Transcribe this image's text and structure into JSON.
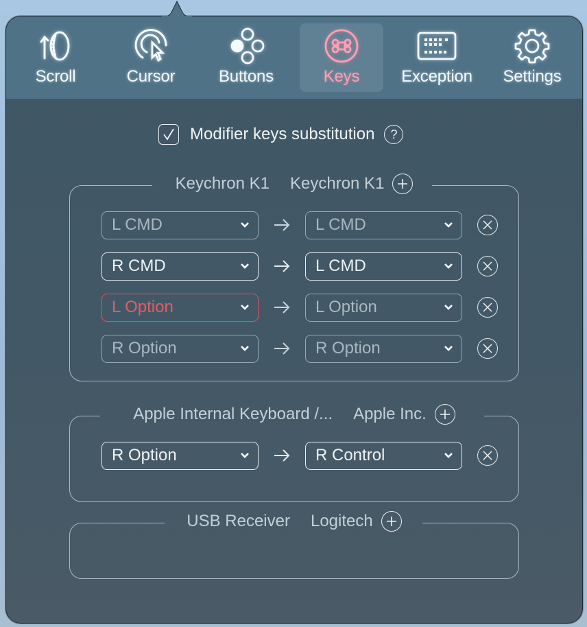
{
  "tabs": [
    {
      "id": "scroll",
      "label": "Scroll",
      "icon": "scroll-wheel-icon",
      "active": false
    },
    {
      "id": "cursor",
      "label": "Cursor",
      "icon": "cursor-icon",
      "active": false
    },
    {
      "id": "buttons",
      "label": "Buttons",
      "icon": "buttons-icon",
      "active": false
    },
    {
      "id": "keys",
      "label": "Keys",
      "icon": "command-key-icon",
      "active": true
    },
    {
      "id": "exception",
      "label": "Exception",
      "icon": "keyboard-icon",
      "active": false
    },
    {
      "id": "settings",
      "label": "Settings",
      "icon": "gear-icon",
      "active": false
    }
  ],
  "modifier": {
    "label": "Modifier keys substitution",
    "checked": true,
    "help_icon": "question-circle-icon"
  },
  "colors": {
    "active_tab": "#ff9fb4",
    "error": "#e2535e",
    "toolbar": "#4f7287",
    "panel": "#415765"
  },
  "devices": [
    {
      "name": "Keychron K1",
      "vendor": "Keychron K1",
      "mappings": [
        {
          "from": "L CMD",
          "to": "L CMD",
          "from_state": "dim",
          "to_state": "dim"
        },
        {
          "from": "R CMD",
          "to": "L CMD",
          "from_state": "bright",
          "to_state": "bright"
        },
        {
          "from": "L Option",
          "to": "L Option",
          "from_state": "error",
          "to_state": "dim"
        },
        {
          "from": "R Option",
          "to": "R Option",
          "from_state": "dim",
          "to_state": "dim"
        }
      ]
    },
    {
      "name": "Apple Internal Keyboard /...",
      "vendor": "Apple Inc.",
      "mappings": [
        {
          "from": "R Option",
          "to": "R Control",
          "from_state": "bright",
          "to_state": "bright"
        }
      ]
    },
    {
      "name": "USB Receiver",
      "vendor": "Logitech",
      "mappings": []
    }
  ]
}
